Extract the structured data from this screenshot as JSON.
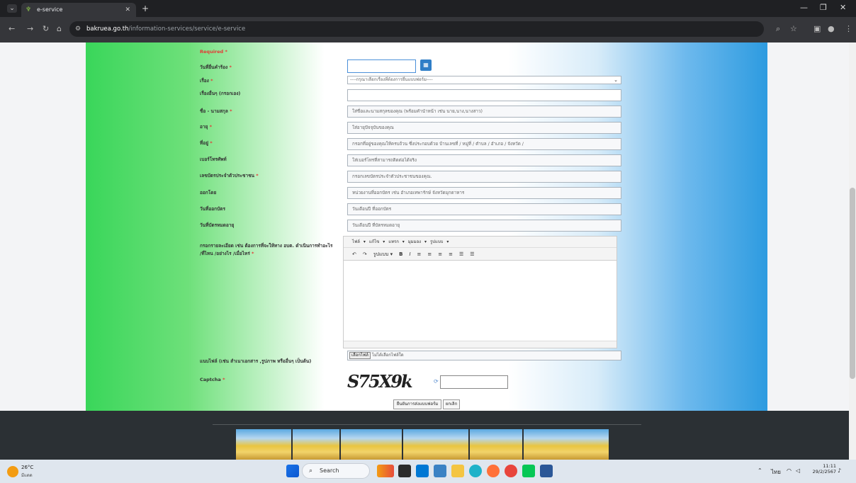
{
  "browser": {
    "tab_title": "e-service",
    "url_host": "bakruea.go.th",
    "url_path": "/information-services/service/e-service"
  },
  "form": {
    "required_note": "Required *",
    "labels": {
      "date": "วันที่ยื่นคำร้อง",
      "subject": "เรื่อง",
      "other_subject": "เรื่องอื่นๆ (กรอกเอง)",
      "name": "ชื่อ - นามสกุล",
      "age": "อายุ",
      "address": "ที่อยู่",
      "phone": "เบอร์โทรศัพท์",
      "id_card": "เลขบัตรประจำตัวประชาชน",
      "issued_by": "ออกโดย",
      "issue_date": "วันที่ออกบัตร",
      "expiry_date": "วันที่บัตรหมดอายุ",
      "details": "กรอกรายละเอียด เช่น ต้องการที่จะให้ทาง อบต. ดำเนินการทำอะไร /ที่ไหน /อย่างไร /เมื่อไหร่",
      "attachment": "แนบไฟล์ (เช่น สำเนาเอกสาร ,รูปภาพ หรืออื่นๆ เป็นต้น)",
      "captcha": "Captcha"
    },
    "required_mark": "*",
    "select_value": "----กรุณาเลือกเรื่องที่ต้องการยื่นแบบฟอร์ม----",
    "placeholders": {
      "name": "ใส่ชื่อและนามสกุลของคุณ (พร้อมคำนำหน้า เช่น นาย,นาง,นางสาว)",
      "age": "ใส่อายุปัจจุบันของคุณ",
      "address": "กรอกที่อยู่ของคุณให้ครบถ้วน ซึ่งประกอบด้วย บ้านเลขที่ / หมู่ที่ / ตำบล / อำเภอ / จังหวัด /",
      "phone": "ใส่เบอร์โทรที่สามารถติดต่อได้จริง",
      "id_card": "กรอกเลขบัตรประจำตัวประชาชนของคุณ.",
      "issued_by": "หน่วยงานที่ออกบัตร เช่น อำเภอเทพารักษ์ จังหวัดมุกดาหาร",
      "issue_date": "วันเดือนปี ที่ออกบัตร",
      "expiry_date": "วันเดือนปี ที่บัตรหมดอายุ"
    },
    "editor_menu": "ไฟล์ ▾   แก้ไข ▾   แทรก ▾   มุมมอง ▾   รูปแบบ ▾",
    "editor_toolbar": [
      "↶",
      "↷",
      "รูปแบบ ▾",
      "B",
      "I",
      "≡",
      "≡",
      "≡",
      "≡",
      "☰",
      "☰"
    ],
    "file_button": "เลือกไฟล์",
    "file_status": "ไม่ได้เลือกไฟล์ใด",
    "captcha_text": "S75X9k",
    "submit_label": "ยืนยันการส่งแบบฟอร์ม",
    "cancel_label": "ยกเลิก"
  },
  "taskbar": {
    "temperature": "26°C",
    "weather": "มีแดด",
    "search_label": "Search",
    "language": "ไทย",
    "time": "11:11",
    "date": "29/2/2567"
  },
  "colors": {
    "accent_blue": "#2f7ec7",
    "required_red": "#e53935",
    "gradient_green": "#39d65a",
    "gradient_blue": "#2d9be0"
  }
}
